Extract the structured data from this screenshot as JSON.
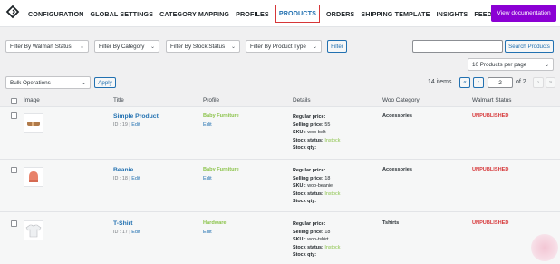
{
  "nav": {
    "items": [
      "CONFIGURATION",
      "GLOBAL SETTINGS",
      "CATEGORY MAPPING",
      "PROFILES",
      "PRODUCTS",
      "ORDERS",
      "SHIPPING TEMPLATE",
      "INSIGHTS",
      "FEEDS"
    ],
    "active": "PRODUCTS",
    "doc_button": "View documentation"
  },
  "filters": {
    "walmart_status": "Filter By Walmart Status",
    "category": "Filter By Category",
    "stock_status": "Filter By Stock Status",
    "product_type": "Filter By Product Type",
    "filter_button": "Filter",
    "search_placeholder": "",
    "search_button": "Search Products",
    "per_page": "10 Products per page"
  },
  "bulk": {
    "select": "Bulk Operations",
    "apply": "Apply"
  },
  "pagination": {
    "items": "14 items",
    "first": "«",
    "prev": "‹",
    "current": "2",
    "of": "of 2",
    "next": "›",
    "last": "»"
  },
  "columns": [
    "Image",
    "Title",
    "Profile",
    "Details",
    "Woo Category",
    "Walmart Status"
  ],
  "detail_labels": {
    "regular": "Regular price:",
    "selling": "Selling price:",
    "sku": "SKU :",
    "stock": "Stock status:",
    "qty": "Stock qty:"
  },
  "rows": [
    {
      "title": "Simple Product",
      "id": "ID : 19",
      "sep": " | ",
      "edit": "Edit",
      "profile": "Baby Furniture",
      "profile_edit": "Edit",
      "regular_price": "",
      "selling_price": "55",
      "sku": "woo-belt",
      "stock_status": "Instock",
      "stock_qty": "",
      "category": "Accessories",
      "status": "UNPUBLISHED"
    },
    {
      "title": "Beanie",
      "id": "ID : 18",
      "sep": " | ",
      "edit": "Edit",
      "profile": "Baby Furniture",
      "profile_edit": "Edit",
      "regular_price": "",
      "selling_price": "18",
      "sku": "woo-beanie",
      "stock_status": "Instock",
      "stock_qty": "",
      "category": "Accessories",
      "status": "UNPUBLISHED"
    },
    {
      "title": "T-Shirt",
      "id": "ID : 17",
      "sep": " | ",
      "edit": "Edit",
      "profile": "Hardware",
      "profile_edit": "Edit",
      "regular_price": "",
      "selling_price": "18",
      "sku": "woo-tshirt",
      "stock_status": "Instock",
      "stock_qty": "",
      "category": "Tshirts",
      "status": "UNPUBLISHED"
    }
  ],
  "colors": {
    "accent": "#2271b1",
    "doc_button": "#8b00d4",
    "status_red": "#d63638",
    "green": "#8bc34a"
  }
}
